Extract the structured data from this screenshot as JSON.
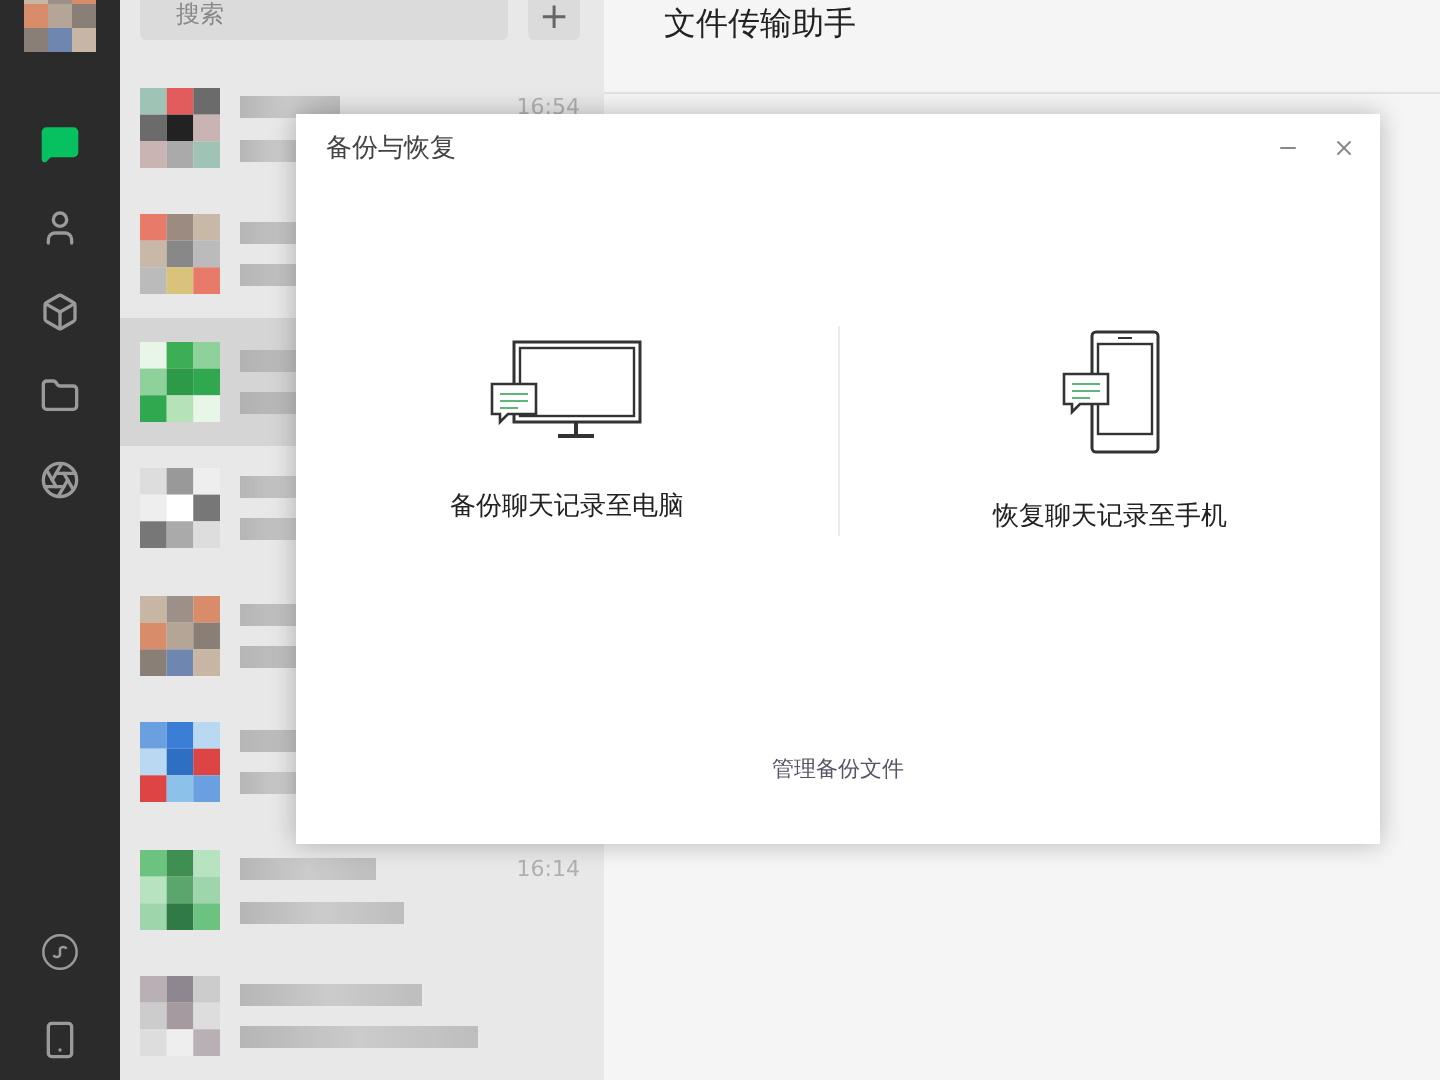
{
  "sidebar": {
    "items": [
      {
        "kind": "chat",
        "selected": true
      },
      {
        "kind": "contacts",
        "selected": false
      },
      {
        "kind": "favorites",
        "selected": false
      },
      {
        "kind": "files",
        "selected": false
      },
      {
        "kind": "moments",
        "selected": false
      }
    ],
    "bottom_items": [
      {
        "kind": "miniprogram"
      },
      {
        "kind": "phone"
      }
    ]
  },
  "search": {
    "placeholder": "搜索",
    "add_button": "+"
  },
  "chats": [
    {
      "time": "16:54",
      "selected": false
    },
    {
      "selected": false
    },
    {
      "selected": true
    },
    {
      "selected": false
    },
    {
      "selected": false
    },
    {
      "selected": false
    },
    {
      "time": "16:14",
      "selected": false
    },
    {
      "selected": false
    }
  ],
  "chat_title": "文件传输助手",
  "dialog": {
    "title": "备份与恢复",
    "options": [
      {
        "kind": "computer",
        "label": "备份聊天记录至电脑"
      },
      {
        "kind": "phone",
        "label": "恢复聊天记录至手机"
      }
    ],
    "link": "管理备份文件"
  }
}
